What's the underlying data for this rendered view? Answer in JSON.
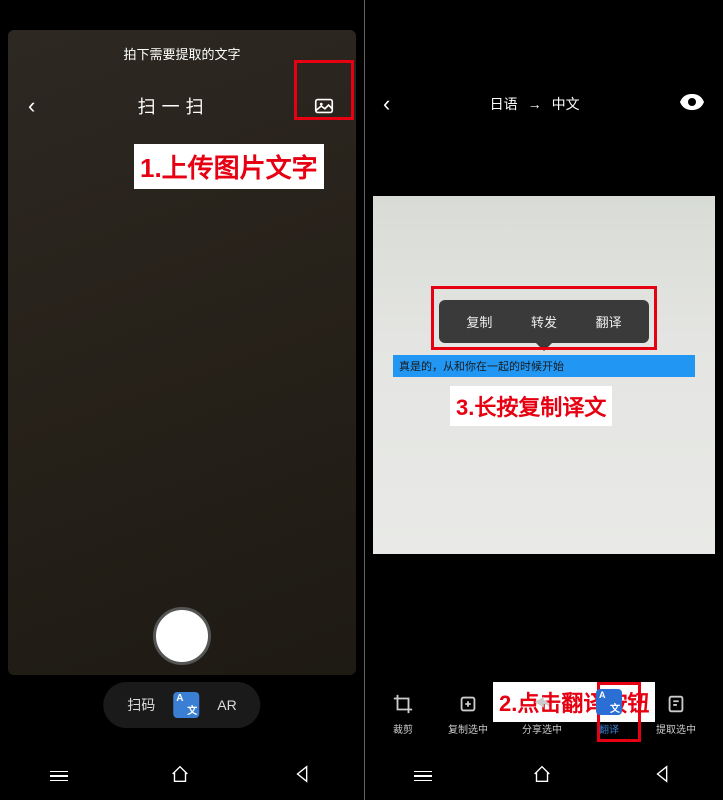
{
  "left": {
    "hint": "拍下需要提取的文字",
    "title": "扫一扫",
    "modes": {
      "scan": "扫码",
      "ar": "AR"
    }
  },
  "right": {
    "lang_from": "日语",
    "lang_to": "中文",
    "highlight_text": "真是的，从和你在一起的时候开始",
    "context_menu": {
      "copy": "复制",
      "forward": "转发",
      "translate": "翻译"
    },
    "actions": {
      "crop": "裁剪",
      "copy_sel": "复制选中",
      "share_sel": "分享选中",
      "translate": "翻译",
      "extract_sel": "提取选中"
    }
  },
  "annotations": {
    "a1": "1.上传图片文字",
    "a2": "2.点击翻译按钮",
    "a3": "3.长按复制译文"
  },
  "colors": {
    "accent_red": "#e60012",
    "accent_blue": "#2b6fd4",
    "highlight": "#2196f3"
  }
}
